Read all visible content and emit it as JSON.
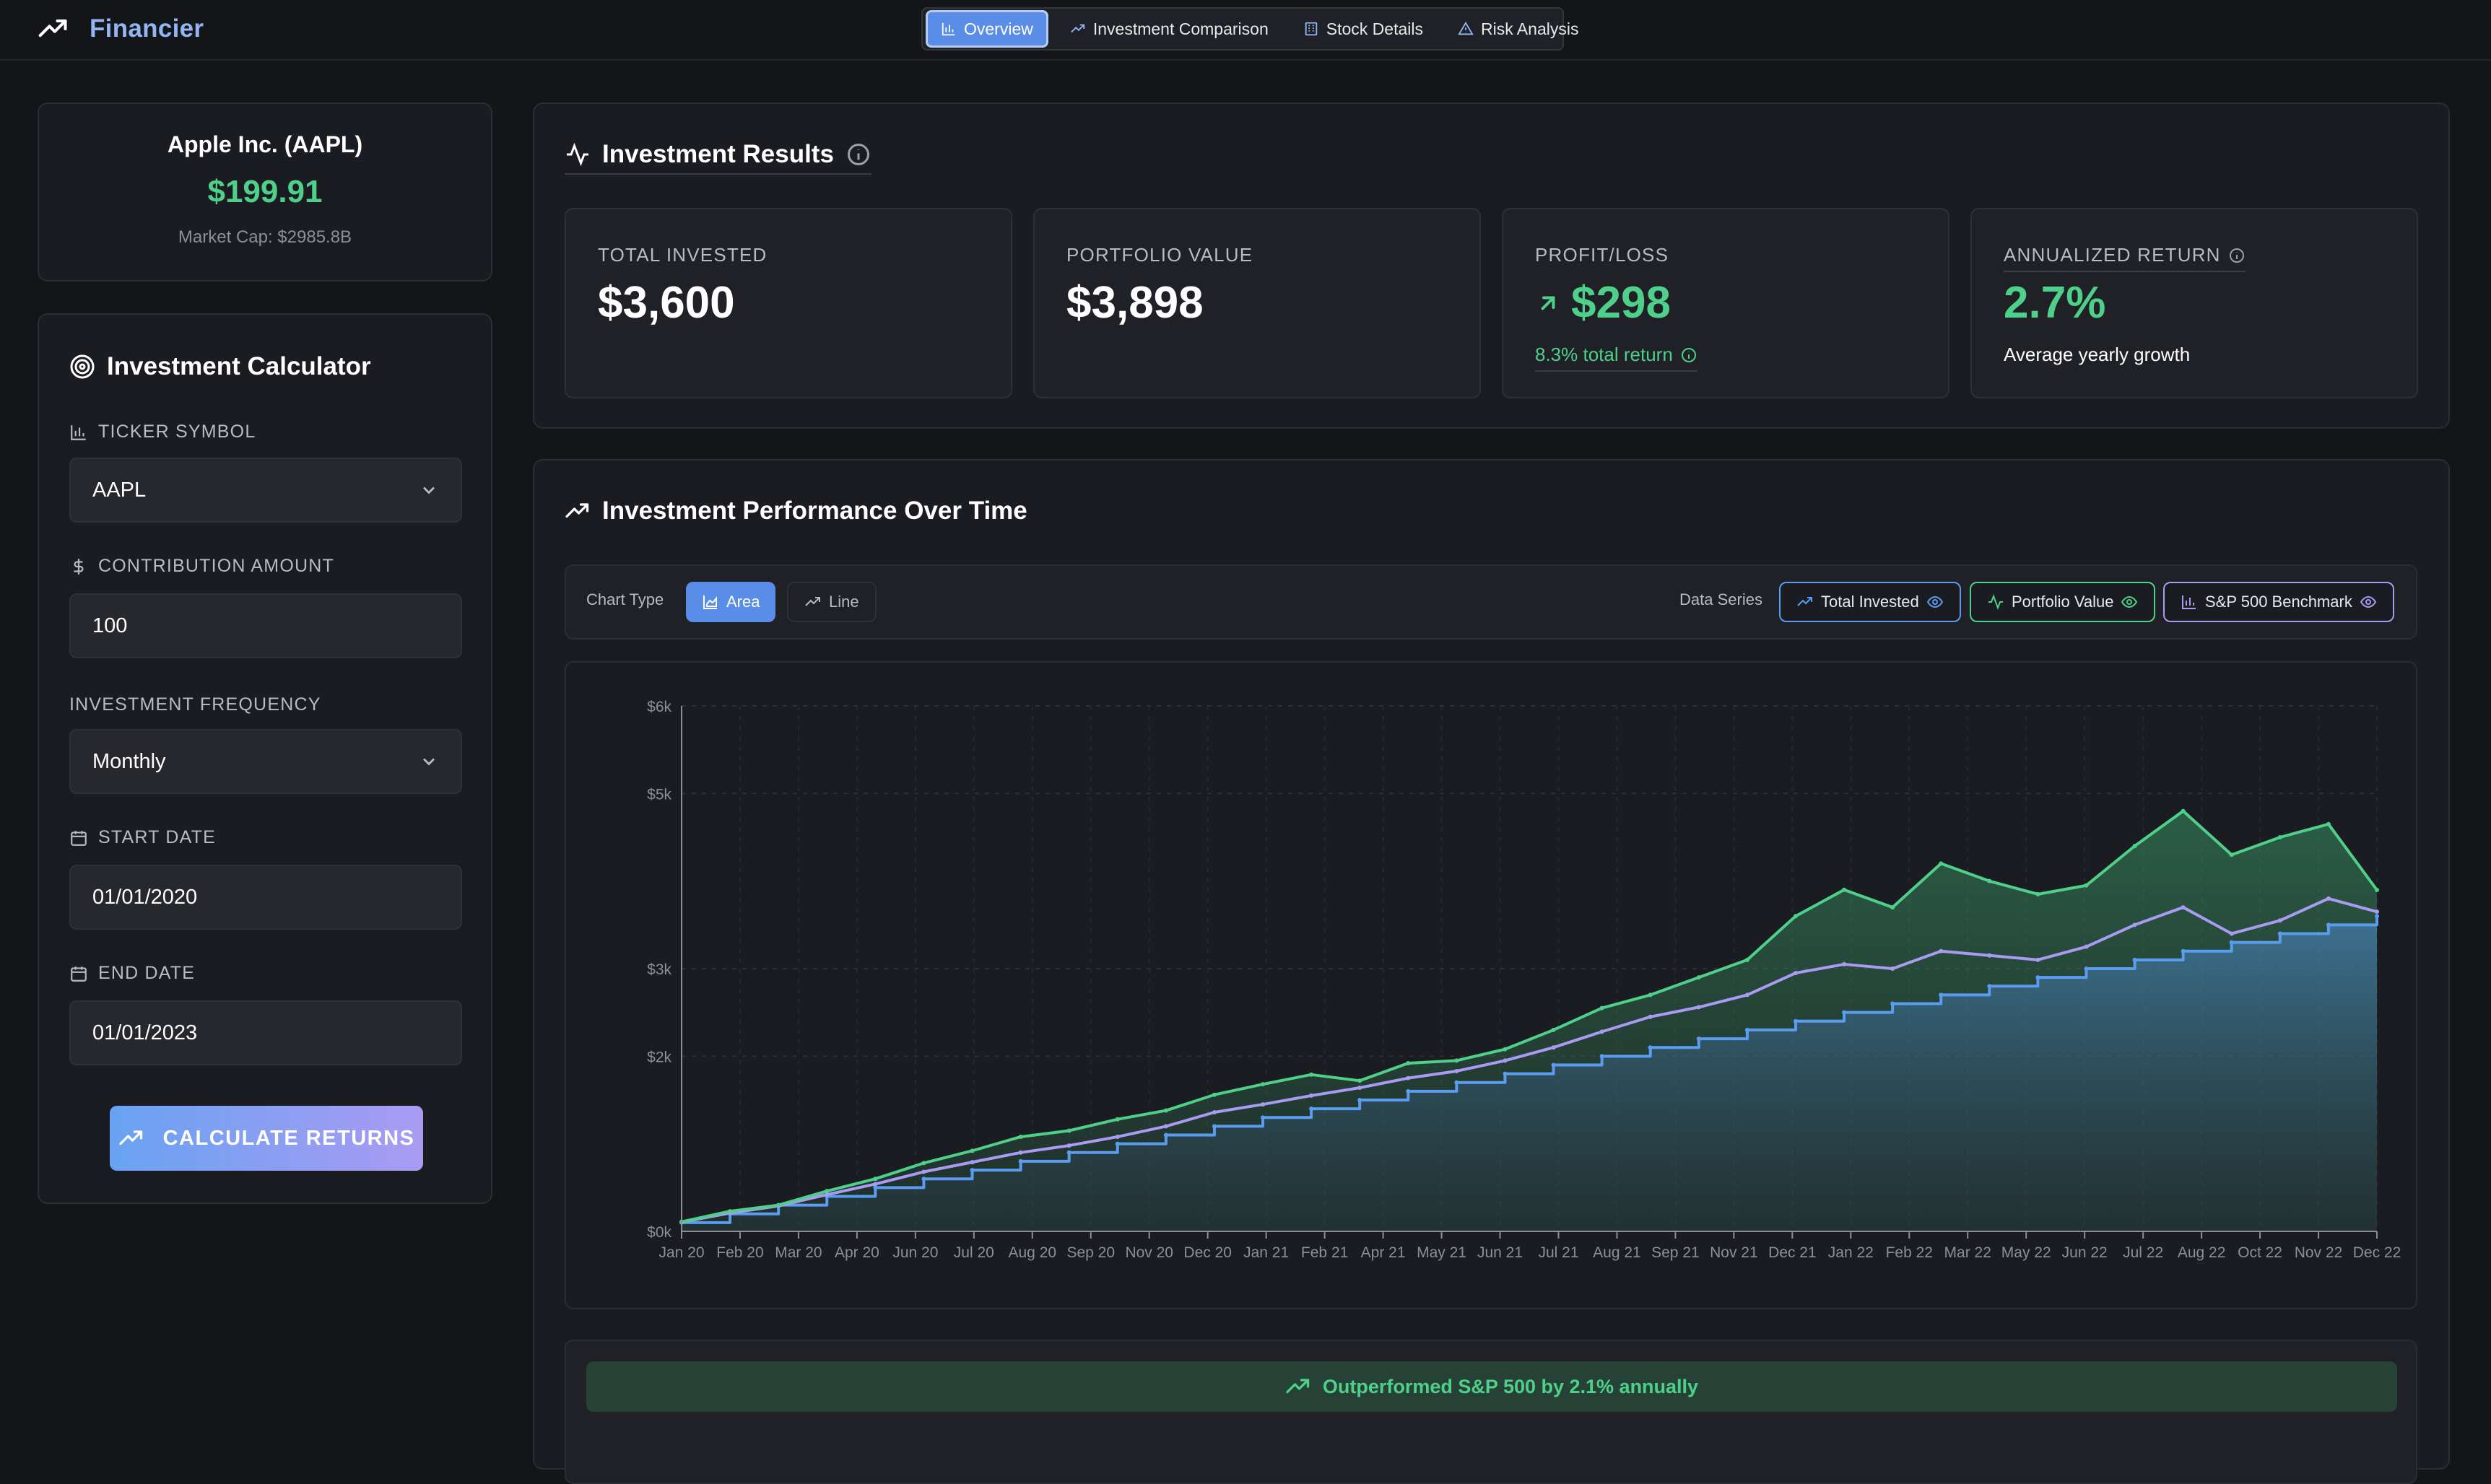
{
  "app": {
    "name": "Financier"
  },
  "nav": {
    "tabs": [
      {
        "label": "Overview",
        "icon": "bar-chart-icon",
        "active": true
      },
      {
        "label": "Investment Comparison",
        "icon": "trending-up-icon",
        "active": false
      },
      {
        "label": "Stock Details",
        "icon": "building-icon",
        "active": false
      },
      {
        "label": "Risk Analysis",
        "icon": "warning-icon",
        "active": false
      }
    ]
  },
  "ticker_card": {
    "name": "Apple Inc. (AAPL)",
    "price": "$199.91",
    "market_cap": "Market Cap: $2985.8B"
  },
  "calculator": {
    "title": "Investment Calculator",
    "ticker_label": "TICKER SYMBOL",
    "ticker_value": "AAPL",
    "contribution_label": "CONTRIBUTION AMOUNT",
    "contribution_value": "100",
    "frequency_label": "INVESTMENT FREQUENCY",
    "frequency_value": "Monthly",
    "start_label": "START DATE",
    "start_value": "01/01/2020",
    "end_label": "END DATE",
    "end_value": "01/01/2023",
    "button_label": "CALCULATE RETURNS"
  },
  "results": {
    "title": "Investment Results",
    "total_invested": {
      "label": "TOTAL INVESTED",
      "value": "$3,600"
    },
    "portfolio_value": {
      "label": "PORTFOLIO VALUE",
      "value": "$3,898"
    },
    "profit_loss": {
      "label": "PROFIT/LOSS",
      "value": "$298",
      "sub": "8.3% total return"
    },
    "annualized": {
      "label": "ANNUALIZED RETURN",
      "value": "2.7%",
      "sub": "Average yearly growth"
    }
  },
  "performance": {
    "title": "Investment Performance Over Time",
    "chart_type_label": "Chart Type",
    "chart_type_area": "Area",
    "chart_type_line": "Line",
    "data_series_label": "Data Series",
    "series_total": "Total Invested",
    "series_portfolio": "Portfolio Value",
    "series_sp500": "S&P 500 Benchmark",
    "summary": "Outperformed S&P 500 by 2.1% annually"
  },
  "colors": {
    "accent": "#5a8de8",
    "green": "#4fd08a",
    "blue_line": "#5a9cf0",
    "purple_line": "#a99bf2"
  },
  "chart_data": {
    "type": "area",
    "y_tick_labels": [
      "$0k",
      "$2k",
      "$3k",
      "$5k",
      "$6k"
    ],
    "y_ticks": [
      0,
      2000,
      3000,
      5000,
      6000
    ],
    "ylim": [
      0,
      6000
    ],
    "x_tick_labels": [
      "Jan 20",
      "Feb 20",
      "Mar 20",
      "Apr 20",
      "Jun 20",
      "Jul 20",
      "Aug 20",
      "Sep 20",
      "Nov 20",
      "Dec 20",
      "Jan 21",
      "Feb 21",
      "Apr 21",
      "May 21",
      "Jun 21",
      "Jul 21",
      "Aug 21",
      "Sep 21",
      "Nov 21",
      "Dec 21",
      "Jan 22",
      "Feb 22",
      "Mar 22",
      "May 22",
      "Jun 22",
      "Jul 22",
      "Aug 22",
      "Oct 22",
      "Nov 22",
      "Dec 22"
    ],
    "grid": true,
    "series": [
      {
        "name": "Total Invested",
        "color": "#5a9cf0",
        "step": true,
        "x": [
          "2020-01",
          "2020-02",
          "2020-03",
          "2020-04",
          "2020-05",
          "2020-06",
          "2020-07",
          "2020-08",
          "2020-09",
          "2020-10",
          "2020-11",
          "2020-12",
          "2021-01",
          "2021-02",
          "2021-03",
          "2021-04",
          "2021-05",
          "2021-06",
          "2021-07",
          "2021-08",
          "2021-09",
          "2021-10",
          "2021-11",
          "2021-12",
          "2022-01",
          "2022-02",
          "2022-03",
          "2022-04",
          "2022-05",
          "2022-06",
          "2022-07",
          "2022-08",
          "2022-09",
          "2022-10",
          "2022-11",
          "2022-12"
        ],
        "values": [
          100,
          200,
          300,
          400,
          500,
          600,
          700,
          800,
          900,
          1000,
          1100,
          1200,
          1300,
          1400,
          1500,
          1600,
          1700,
          1800,
          1900,
          2000,
          2100,
          2200,
          2300,
          2400,
          2500,
          2600,
          2700,
          2800,
          2900,
          3000,
          3100,
          3200,
          3300,
          3400,
          3500,
          3600
        ]
      },
      {
        "name": "Portfolio Value",
        "color": "#4fd08a",
        "x": [
          "2020-01",
          "2020-02",
          "2020-03",
          "2020-04",
          "2020-05",
          "2020-06",
          "2020-07",
          "2020-08",
          "2020-09",
          "2020-10",
          "2020-11",
          "2020-12",
          "2021-01",
          "2021-02",
          "2021-03",
          "2021-04",
          "2021-05",
          "2021-06",
          "2021-07",
          "2021-08",
          "2021-09",
          "2021-10",
          "2021-11",
          "2021-12",
          "2022-01",
          "2022-02",
          "2022-03",
          "2022-04",
          "2022-05",
          "2022-06",
          "2022-07",
          "2022-08",
          "2022-09",
          "2022-10",
          "2022-11",
          "2022-12"
        ],
        "values": [
          110,
          230,
          300,
          460,
          600,
          780,
          920,
          1080,
          1150,
          1280,
          1380,
          1560,
          1680,
          1790,
          1720,
          1920,
          1950,
          2080,
          2300,
          2550,
          2700,
          2900,
          3100,
          3600,
          3900,
          3700,
          4200,
          4000,
          3850,
          3950,
          4400,
          4800,
          4300,
          4500,
          4650,
          3898
        ]
      },
      {
        "name": "S&P 500 Benchmark",
        "color": "#a99bf2",
        "x": [
          "2020-01",
          "2020-02",
          "2020-03",
          "2020-04",
          "2020-05",
          "2020-06",
          "2020-07",
          "2020-08",
          "2020-09",
          "2020-10",
          "2020-11",
          "2020-12",
          "2021-01",
          "2021-02",
          "2021-03",
          "2021-04",
          "2021-05",
          "2021-06",
          "2021-07",
          "2021-08",
          "2021-09",
          "2021-10",
          "2021-11",
          "2021-12",
          "2022-01",
          "2022-02",
          "2022-03",
          "2022-04",
          "2022-05",
          "2022-06",
          "2022-07",
          "2022-08",
          "2022-09",
          "2022-10",
          "2022-11",
          "2022-12"
        ],
        "values": [
          105,
          210,
          290,
          420,
          540,
          680,
          790,
          900,
          980,
          1080,
          1200,
          1360,
          1450,
          1550,
          1640,
          1750,
          1830,
          1950,
          2100,
          2280,
          2450,
          2560,
          2700,
          2950,
          3050,
          3000,
          3200,
          3150,
          3100,
          3250,
          3500,
          3700,
          3400,
          3550,
          3800,
          3650
        ]
      }
    ]
  }
}
